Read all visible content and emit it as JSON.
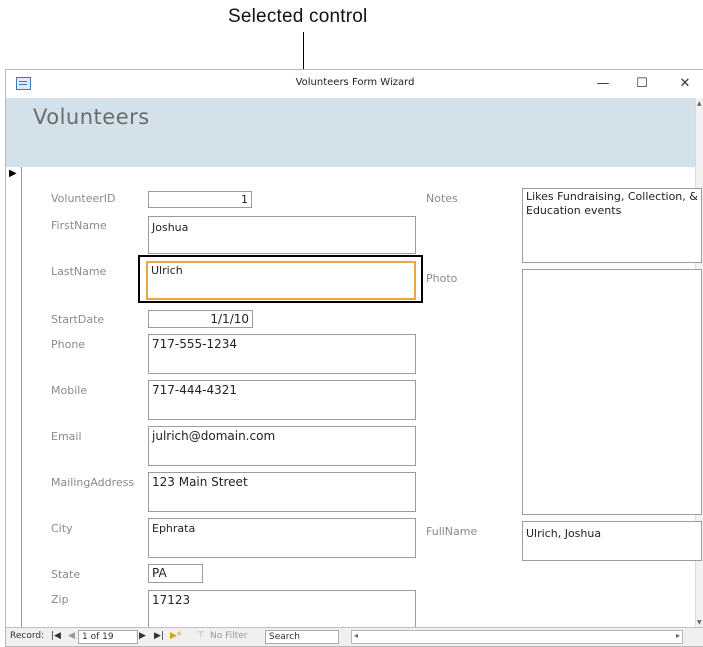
{
  "callout": {
    "label": "Selected control"
  },
  "window": {
    "title": "Volunteers Form Wizard",
    "minimize": "—",
    "maximize": "☐",
    "close": "✕"
  },
  "form": {
    "header_title": "Volunteers",
    "record_selector": "▶",
    "fields": {
      "volunteer_id": {
        "label": "VolunteerID",
        "value": "1"
      },
      "first_name": {
        "label": "FirstName",
        "value": "Joshua"
      },
      "last_name": {
        "label": "LastName",
        "value": "Ulrich"
      },
      "start_date": {
        "label": "StartDate",
        "value": "1/1/10"
      },
      "phone": {
        "label": "Phone",
        "value": "717-555-1234"
      },
      "mobile": {
        "label": "Mobile",
        "value": "717-444-4321"
      },
      "email": {
        "label": "Email",
        "value": "julrich@domain.com"
      },
      "mailing_address": {
        "label": "MailingAddress",
        "value": "123 Main Street"
      },
      "city": {
        "label": "City",
        "value": "Ephrata"
      },
      "state": {
        "label": "State",
        "value": "PA"
      },
      "zip": {
        "label": "Zip",
        "value": "17123"
      },
      "notes": {
        "label": "Notes",
        "value": "Likes Fundraising, Collection, & Education events"
      },
      "photo": {
        "label": "Photo",
        "value": ""
      },
      "full_name": {
        "label": "FullName",
        "value": "Ulrich,  Joshua"
      }
    }
  },
  "navigation": {
    "record_label": "Record:",
    "first": "|◀",
    "prev": "◀",
    "position": "1 of 19",
    "next": "▶",
    "last": "▶|",
    "new": "▶*",
    "filter_icon": "funnel-icon",
    "filter_label": "No Filter",
    "search": "Search"
  }
}
